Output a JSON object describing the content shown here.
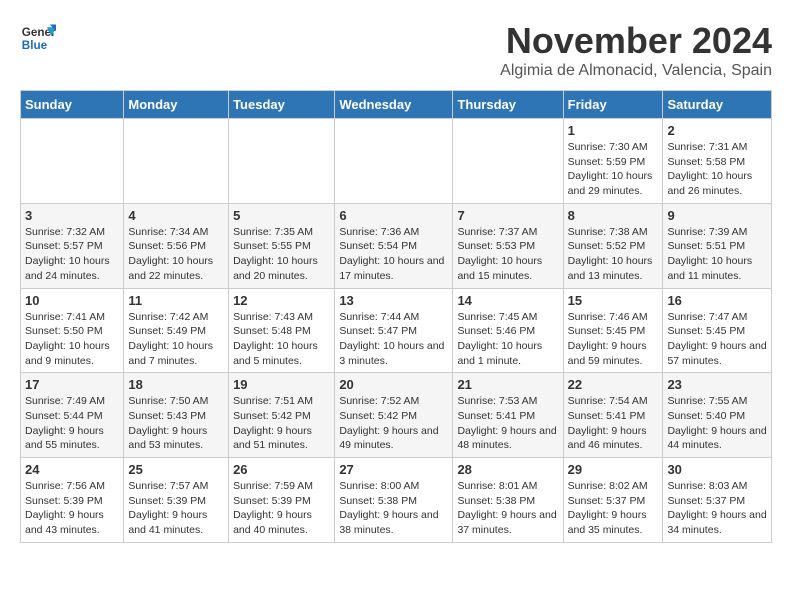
{
  "logo": {
    "line1": "General",
    "line2": "Blue"
  },
  "header": {
    "month": "November 2024",
    "location": "Algimia de Almonacid, Valencia, Spain"
  },
  "weekdays": [
    "Sunday",
    "Monday",
    "Tuesday",
    "Wednesday",
    "Thursday",
    "Friday",
    "Saturday"
  ],
  "weeks": [
    [
      {
        "day": "",
        "info": ""
      },
      {
        "day": "",
        "info": ""
      },
      {
        "day": "",
        "info": ""
      },
      {
        "day": "",
        "info": ""
      },
      {
        "day": "",
        "info": ""
      },
      {
        "day": "1",
        "info": "Sunrise: 7:30 AM\nSunset: 5:59 PM\nDaylight: 10 hours and 29 minutes."
      },
      {
        "day": "2",
        "info": "Sunrise: 7:31 AM\nSunset: 5:58 PM\nDaylight: 10 hours and 26 minutes."
      }
    ],
    [
      {
        "day": "3",
        "info": "Sunrise: 7:32 AM\nSunset: 5:57 PM\nDaylight: 10 hours and 24 minutes."
      },
      {
        "day": "4",
        "info": "Sunrise: 7:34 AM\nSunset: 5:56 PM\nDaylight: 10 hours and 22 minutes."
      },
      {
        "day": "5",
        "info": "Sunrise: 7:35 AM\nSunset: 5:55 PM\nDaylight: 10 hours and 20 minutes."
      },
      {
        "day": "6",
        "info": "Sunrise: 7:36 AM\nSunset: 5:54 PM\nDaylight: 10 hours and 17 minutes."
      },
      {
        "day": "7",
        "info": "Sunrise: 7:37 AM\nSunset: 5:53 PM\nDaylight: 10 hours and 15 minutes."
      },
      {
        "day": "8",
        "info": "Sunrise: 7:38 AM\nSunset: 5:52 PM\nDaylight: 10 hours and 13 minutes."
      },
      {
        "day": "9",
        "info": "Sunrise: 7:39 AM\nSunset: 5:51 PM\nDaylight: 10 hours and 11 minutes."
      }
    ],
    [
      {
        "day": "10",
        "info": "Sunrise: 7:41 AM\nSunset: 5:50 PM\nDaylight: 10 hours and 9 minutes."
      },
      {
        "day": "11",
        "info": "Sunrise: 7:42 AM\nSunset: 5:49 PM\nDaylight: 10 hours and 7 minutes."
      },
      {
        "day": "12",
        "info": "Sunrise: 7:43 AM\nSunset: 5:48 PM\nDaylight: 10 hours and 5 minutes."
      },
      {
        "day": "13",
        "info": "Sunrise: 7:44 AM\nSunset: 5:47 PM\nDaylight: 10 hours and 3 minutes."
      },
      {
        "day": "14",
        "info": "Sunrise: 7:45 AM\nSunset: 5:46 PM\nDaylight: 10 hours and 1 minute."
      },
      {
        "day": "15",
        "info": "Sunrise: 7:46 AM\nSunset: 5:45 PM\nDaylight: 9 hours and 59 minutes."
      },
      {
        "day": "16",
        "info": "Sunrise: 7:47 AM\nSunset: 5:45 PM\nDaylight: 9 hours and 57 minutes."
      }
    ],
    [
      {
        "day": "17",
        "info": "Sunrise: 7:49 AM\nSunset: 5:44 PM\nDaylight: 9 hours and 55 minutes."
      },
      {
        "day": "18",
        "info": "Sunrise: 7:50 AM\nSunset: 5:43 PM\nDaylight: 9 hours and 53 minutes."
      },
      {
        "day": "19",
        "info": "Sunrise: 7:51 AM\nSunset: 5:42 PM\nDaylight: 9 hours and 51 minutes."
      },
      {
        "day": "20",
        "info": "Sunrise: 7:52 AM\nSunset: 5:42 PM\nDaylight: 9 hours and 49 minutes."
      },
      {
        "day": "21",
        "info": "Sunrise: 7:53 AM\nSunset: 5:41 PM\nDaylight: 9 hours and 48 minutes."
      },
      {
        "day": "22",
        "info": "Sunrise: 7:54 AM\nSunset: 5:41 PM\nDaylight: 9 hours and 46 minutes."
      },
      {
        "day": "23",
        "info": "Sunrise: 7:55 AM\nSunset: 5:40 PM\nDaylight: 9 hours and 44 minutes."
      }
    ],
    [
      {
        "day": "24",
        "info": "Sunrise: 7:56 AM\nSunset: 5:39 PM\nDaylight: 9 hours and 43 minutes."
      },
      {
        "day": "25",
        "info": "Sunrise: 7:57 AM\nSunset: 5:39 PM\nDaylight: 9 hours and 41 minutes."
      },
      {
        "day": "26",
        "info": "Sunrise: 7:59 AM\nSunset: 5:39 PM\nDaylight: 9 hours and 40 minutes."
      },
      {
        "day": "27",
        "info": "Sunrise: 8:00 AM\nSunset: 5:38 PM\nDaylight: 9 hours and 38 minutes."
      },
      {
        "day": "28",
        "info": "Sunrise: 8:01 AM\nSunset: 5:38 PM\nDaylight: 9 hours and 37 minutes."
      },
      {
        "day": "29",
        "info": "Sunrise: 8:02 AM\nSunset: 5:37 PM\nDaylight: 9 hours and 35 minutes."
      },
      {
        "day": "30",
        "info": "Sunrise: 8:03 AM\nSunset: 5:37 PM\nDaylight: 9 hours and 34 minutes."
      }
    ]
  ]
}
